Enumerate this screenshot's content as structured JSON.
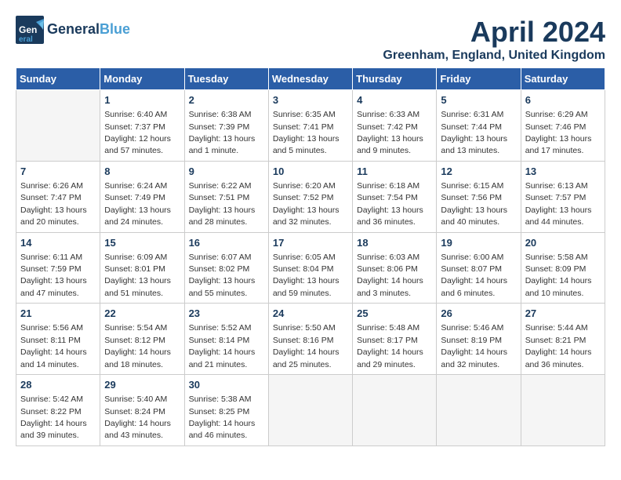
{
  "header": {
    "logo_general": "General",
    "logo_blue": "Blue",
    "month": "April 2024",
    "location": "Greenham, England, United Kingdom"
  },
  "weekdays": [
    "Sunday",
    "Monday",
    "Tuesday",
    "Wednesday",
    "Thursday",
    "Friday",
    "Saturday"
  ],
  "weeks": [
    [
      {
        "day": "",
        "sunrise": "",
        "sunset": "",
        "daylight": ""
      },
      {
        "day": "1",
        "sunrise": "Sunrise: 6:40 AM",
        "sunset": "Sunset: 7:37 PM",
        "daylight": "Daylight: 12 hours and 57 minutes."
      },
      {
        "day": "2",
        "sunrise": "Sunrise: 6:38 AM",
        "sunset": "Sunset: 7:39 PM",
        "daylight": "Daylight: 13 hours and 1 minute."
      },
      {
        "day": "3",
        "sunrise": "Sunrise: 6:35 AM",
        "sunset": "Sunset: 7:41 PM",
        "daylight": "Daylight: 13 hours and 5 minutes."
      },
      {
        "day": "4",
        "sunrise": "Sunrise: 6:33 AM",
        "sunset": "Sunset: 7:42 PM",
        "daylight": "Daylight: 13 hours and 9 minutes."
      },
      {
        "day": "5",
        "sunrise": "Sunrise: 6:31 AM",
        "sunset": "Sunset: 7:44 PM",
        "daylight": "Daylight: 13 hours and 13 minutes."
      },
      {
        "day": "6",
        "sunrise": "Sunrise: 6:29 AM",
        "sunset": "Sunset: 7:46 PM",
        "daylight": "Daylight: 13 hours and 17 minutes."
      }
    ],
    [
      {
        "day": "7",
        "sunrise": "Sunrise: 6:26 AM",
        "sunset": "Sunset: 7:47 PM",
        "daylight": "Daylight: 13 hours and 20 minutes."
      },
      {
        "day": "8",
        "sunrise": "Sunrise: 6:24 AM",
        "sunset": "Sunset: 7:49 PM",
        "daylight": "Daylight: 13 hours and 24 minutes."
      },
      {
        "day": "9",
        "sunrise": "Sunrise: 6:22 AM",
        "sunset": "Sunset: 7:51 PM",
        "daylight": "Daylight: 13 hours and 28 minutes."
      },
      {
        "day": "10",
        "sunrise": "Sunrise: 6:20 AM",
        "sunset": "Sunset: 7:52 PM",
        "daylight": "Daylight: 13 hours and 32 minutes."
      },
      {
        "day": "11",
        "sunrise": "Sunrise: 6:18 AM",
        "sunset": "Sunset: 7:54 PM",
        "daylight": "Daylight: 13 hours and 36 minutes."
      },
      {
        "day": "12",
        "sunrise": "Sunrise: 6:15 AM",
        "sunset": "Sunset: 7:56 PM",
        "daylight": "Daylight: 13 hours and 40 minutes."
      },
      {
        "day": "13",
        "sunrise": "Sunrise: 6:13 AM",
        "sunset": "Sunset: 7:57 PM",
        "daylight": "Daylight: 13 hours and 44 minutes."
      }
    ],
    [
      {
        "day": "14",
        "sunrise": "Sunrise: 6:11 AM",
        "sunset": "Sunset: 7:59 PM",
        "daylight": "Daylight: 13 hours and 47 minutes."
      },
      {
        "day": "15",
        "sunrise": "Sunrise: 6:09 AM",
        "sunset": "Sunset: 8:01 PM",
        "daylight": "Daylight: 13 hours and 51 minutes."
      },
      {
        "day": "16",
        "sunrise": "Sunrise: 6:07 AM",
        "sunset": "Sunset: 8:02 PM",
        "daylight": "Daylight: 13 hours and 55 minutes."
      },
      {
        "day": "17",
        "sunrise": "Sunrise: 6:05 AM",
        "sunset": "Sunset: 8:04 PM",
        "daylight": "Daylight: 13 hours and 59 minutes."
      },
      {
        "day": "18",
        "sunrise": "Sunrise: 6:03 AM",
        "sunset": "Sunset: 8:06 PM",
        "daylight": "Daylight: 14 hours and 3 minutes."
      },
      {
        "day": "19",
        "sunrise": "Sunrise: 6:00 AM",
        "sunset": "Sunset: 8:07 PM",
        "daylight": "Daylight: 14 hours and 6 minutes."
      },
      {
        "day": "20",
        "sunrise": "Sunrise: 5:58 AM",
        "sunset": "Sunset: 8:09 PM",
        "daylight": "Daylight: 14 hours and 10 minutes."
      }
    ],
    [
      {
        "day": "21",
        "sunrise": "Sunrise: 5:56 AM",
        "sunset": "Sunset: 8:11 PM",
        "daylight": "Daylight: 14 hours and 14 minutes."
      },
      {
        "day": "22",
        "sunrise": "Sunrise: 5:54 AM",
        "sunset": "Sunset: 8:12 PM",
        "daylight": "Daylight: 14 hours and 18 minutes."
      },
      {
        "day": "23",
        "sunrise": "Sunrise: 5:52 AM",
        "sunset": "Sunset: 8:14 PM",
        "daylight": "Daylight: 14 hours and 21 minutes."
      },
      {
        "day": "24",
        "sunrise": "Sunrise: 5:50 AM",
        "sunset": "Sunset: 8:16 PM",
        "daylight": "Daylight: 14 hours and 25 minutes."
      },
      {
        "day": "25",
        "sunrise": "Sunrise: 5:48 AM",
        "sunset": "Sunset: 8:17 PM",
        "daylight": "Daylight: 14 hours and 29 minutes."
      },
      {
        "day": "26",
        "sunrise": "Sunrise: 5:46 AM",
        "sunset": "Sunset: 8:19 PM",
        "daylight": "Daylight: 14 hours and 32 minutes."
      },
      {
        "day": "27",
        "sunrise": "Sunrise: 5:44 AM",
        "sunset": "Sunset: 8:21 PM",
        "daylight": "Daylight: 14 hours and 36 minutes."
      }
    ],
    [
      {
        "day": "28",
        "sunrise": "Sunrise: 5:42 AM",
        "sunset": "Sunset: 8:22 PM",
        "daylight": "Daylight: 14 hours and 39 minutes."
      },
      {
        "day": "29",
        "sunrise": "Sunrise: 5:40 AM",
        "sunset": "Sunset: 8:24 PM",
        "daylight": "Daylight: 14 hours and 43 minutes."
      },
      {
        "day": "30",
        "sunrise": "Sunrise: 5:38 AM",
        "sunset": "Sunset: 8:25 PM",
        "daylight": "Daylight: 14 hours and 46 minutes."
      },
      {
        "day": "",
        "sunrise": "",
        "sunset": "",
        "daylight": ""
      },
      {
        "day": "",
        "sunrise": "",
        "sunset": "",
        "daylight": ""
      },
      {
        "day": "",
        "sunrise": "",
        "sunset": "",
        "daylight": ""
      },
      {
        "day": "",
        "sunrise": "",
        "sunset": "",
        "daylight": ""
      }
    ]
  ]
}
